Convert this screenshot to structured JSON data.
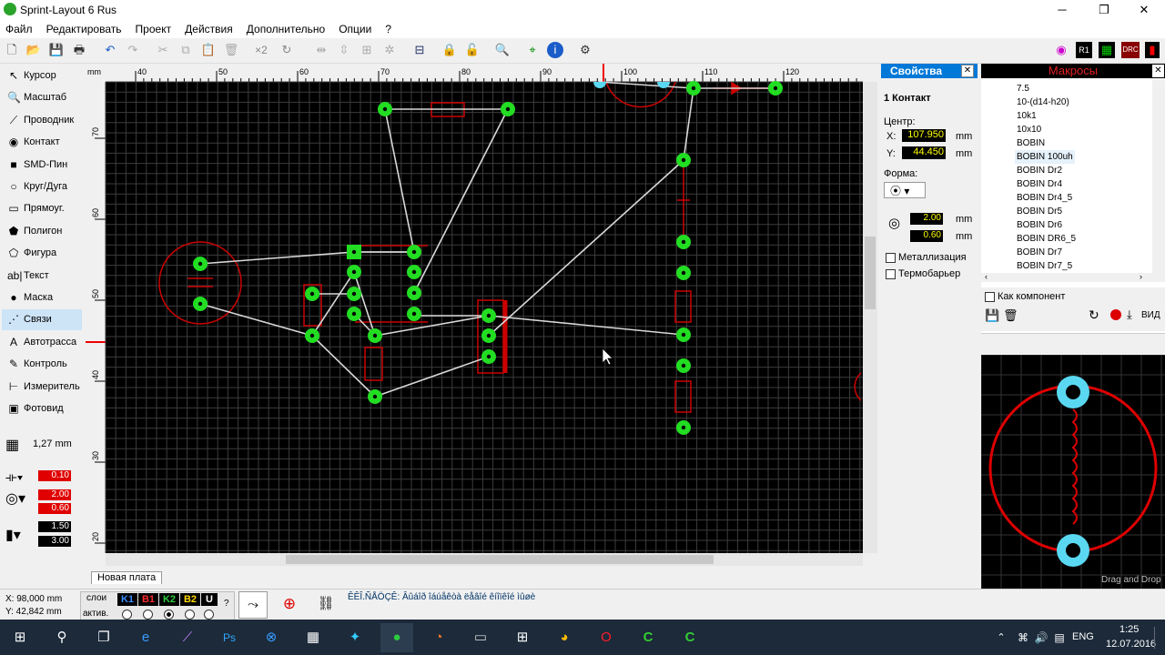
{
  "app": {
    "title": "Sprint-Layout 6 Rus",
    "min": "─",
    "max": "❐",
    "close": "✕"
  },
  "menu": [
    "Файл",
    "Редактировать",
    "Проект",
    "Действия",
    "Дополнительно",
    "Опции",
    "?"
  ],
  "toolbar": {
    "x2_label": "×2",
    "drc_label": "DRC"
  },
  "tools": [
    {
      "label": "Курсор",
      "icon": "cursor-icon",
      "glyph": "↖"
    },
    {
      "label": "Масштаб",
      "icon": "zoom-icon",
      "glyph": "🔍"
    },
    {
      "label": "Проводник",
      "icon": "wire-icon",
      "glyph": "⟋"
    },
    {
      "label": "Контакт",
      "icon": "pad-icon",
      "glyph": "◉"
    },
    {
      "label": "SMD-Пин",
      "icon": "smd-icon",
      "glyph": "■"
    },
    {
      "label": "Круг/Дуга",
      "icon": "circle-icon",
      "glyph": "○"
    },
    {
      "label": "Прямоуг.",
      "icon": "rect-icon",
      "glyph": "▭"
    },
    {
      "label": "Полигон",
      "icon": "polygon-icon",
      "glyph": "⬟"
    },
    {
      "label": "Фигура",
      "icon": "figure-icon",
      "glyph": "⬠"
    },
    {
      "label": "Текст",
      "icon": "text-icon",
      "glyph": "ab|"
    },
    {
      "label": "Маска",
      "icon": "mask-icon",
      "glyph": "●"
    },
    {
      "label": "Связи",
      "icon": "connections-icon",
      "glyph": "⋰"
    },
    {
      "label": "Автотрасса",
      "icon": "autoroute-icon",
      "glyph": "A"
    },
    {
      "label": "Контроль",
      "icon": "check-icon",
      "glyph": "✎"
    },
    {
      "label": "Измеритель",
      "icon": "measure-icon",
      "glyph": "⊢"
    },
    {
      "label": "Фотовид",
      "icon": "photo-icon",
      "glyph": "▣"
    }
  ],
  "grid": {
    "value": "1,27 mm"
  },
  "params": {
    "track_width": "0.10",
    "pad_outer": "2.00",
    "pad_inner": "0.60",
    "smd_w": "1.50",
    "smd_h": "3.00"
  },
  "ruler": {
    "unit": "mm",
    "top": [
      "40",
      "50",
      "60",
      "70",
      "80",
      "90",
      "100",
      "110",
      "120"
    ],
    "left": [
      "70",
      "60",
      "50",
      "40",
      "30",
      "20"
    ]
  },
  "board_tab": "Новая плата",
  "props": {
    "title": "Свойства",
    "heading": "1 Контакт",
    "center_label": "Центр:",
    "x_label": "X:",
    "x_value": "107.950",
    "y_label": "Y:",
    "y_value": "44.450",
    "unit": "mm",
    "shape_label": "Форма:",
    "outer": "2.00",
    "inner": "0.60",
    "metal": "Металлизация",
    "thermal": "Термобарьер"
  },
  "macros": {
    "title": "Макросы",
    "items": [
      "7.5",
      "10-(d14-h20)",
      "10k1",
      "10x10",
      "BOBIN",
      "BOBIN 100uh",
      "BOBIN Dr2",
      "BOBIN Dr4",
      "BOBIN Dr4_5",
      "BOBIN Dr5",
      "BOBIN Dr6",
      "BOBIN DR6_5",
      "BOBIN Dr7",
      "BOBIN Dr7_5"
    ],
    "selected": "BOBIN 100uh",
    "as_component": "Как компонент",
    "view": "ВИД",
    "drag_drop": "Drag and Drop"
  },
  "status": {
    "x": "X:   98,000 mm",
    "y": "Y:   42,842 mm",
    "layers_label": "слои",
    "active_label": "актив.",
    "layers": [
      "K1",
      "B1",
      "K2",
      "B2",
      "U"
    ],
    "layer_colors": [
      "#3a8cff",
      "#ff2a2a",
      "#2ecc40",
      "#ffd700",
      "#ffffff"
    ],
    "message": "ÊÊÎ.ÑÅÖÇÊ:  Âûáîð îáúåêòà ëåâîé êíîïêîé ìûøè"
  },
  "taskbar": {
    "lang": "ENG",
    "time": "1:25",
    "date": "12.07.2016"
  },
  "colors": {
    "bg": "#000000",
    "grid": "#3c3c3c",
    "pad": "#22dd22",
    "ratsnest": "#d8d8d8",
    "silk": "#cc0000"
  }
}
